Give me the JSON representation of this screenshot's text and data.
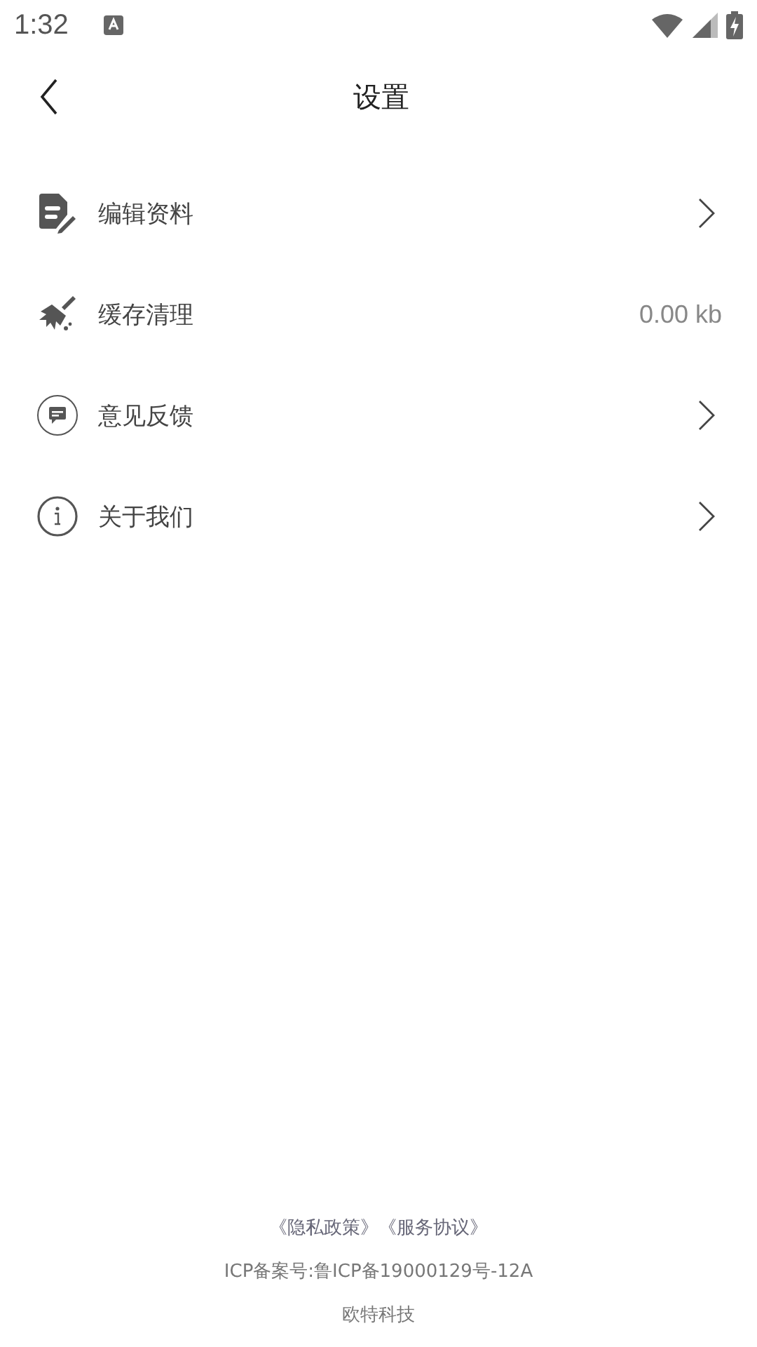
{
  "status_bar": {
    "time": "1:32"
  },
  "header": {
    "title": "设置"
  },
  "items": [
    {
      "label": "编辑资料",
      "kind": "link"
    },
    {
      "label": "缓存清理",
      "kind": "value",
      "value": "0.00 kb"
    },
    {
      "label": "意见反馈",
      "kind": "link"
    },
    {
      "label": "关于我们",
      "kind": "link"
    }
  ],
  "footer": {
    "links": [
      "《隐私政策》",
      "《服务协议》"
    ],
    "icp": "ICP备案号:鲁ICP备19000129号-12A",
    "company": "欧特科技"
  }
}
